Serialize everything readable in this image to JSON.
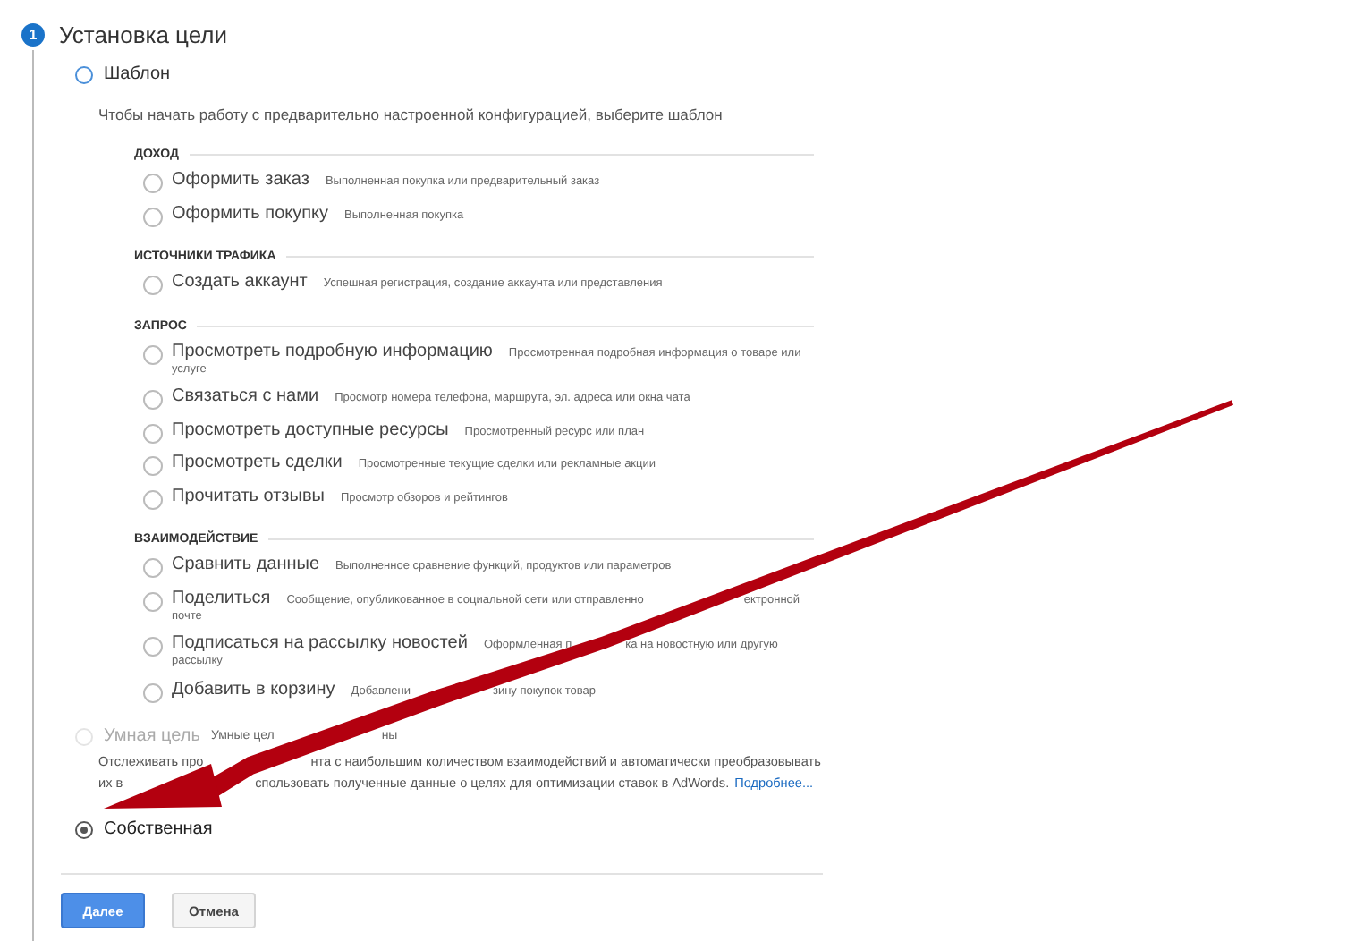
{
  "step": {
    "number": "1",
    "title": "Установка цели"
  },
  "template": {
    "label": "Шаблон",
    "selected": false,
    "hint": "Чтобы начать работу с предварительно настроенной конфигурацией, выберите шаблон",
    "categories": [
      {
        "title": "ДОХОД",
        "options": [
          {
            "label": "Оформить заказ",
            "desc_lines": [
              [
                "Выполненная покупка или предварительный заказ"
              ]
            ],
            "selected": false
          },
          {
            "label": "Оформить покупку",
            "desc_lines": [
              [
                "Выполненная покупка"
              ]
            ],
            "selected": false
          }
        ]
      },
      {
        "title": "ИСТОЧНИКИ ТРАФИКА",
        "options": [
          {
            "label": "Создать аккаунт",
            "desc_lines": [
              [
                "Успешная регистрация, создание аккаунта или представления"
              ]
            ],
            "selected": false
          }
        ]
      },
      {
        "title": "ЗАПРОС",
        "options": [
          {
            "label": "Просмотреть подробную информацию",
            "desc_lines": [
              [
                "Просмотренная подробная информация о товаре или"
              ],
              [
                "услуге"
              ]
            ],
            "selected": false
          },
          {
            "label": "Связаться с нами",
            "desc_lines": [
              [
                "Просмотр номера телефона, маршрута, эл. адреса или окна чата"
              ]
            ],
            "selected": false
          },
          {
            "label": "Просмотреть доступные ресурсы",
            "desc_lines": [
              [
                "Просмотренный ресурс или план"
              ]
            ],
            "selected": false
          },
          {
            "label": "Просмотреть сделки",
            "desc_lines": [
              [
                "Просмотренные текущие сделки или рекламные акции"
              ]
            ],
            "selected": false
          },
          {
            "label": "Прочитать отзывы",
            "desc_lines": [
              [
                "Просмотр обзоров и рейтингов"
              ]
            ],
            "selected": false
          }
        ]
      },
      {
        "title": "ВЗАИМОДЕЙСТВИЕ",
        "options": [
          {
            "label": "Сравнить данные",
            "desc_lines": [
              [
                "Выполненное сравнение функций, продуктов или параметров"
              ]
            ],
            "selected": false
          },
          {
            "label": "Поделиться",
            "desc_lines": [
              [
                "Сообщение, опубликованное в социальной сети или отправленно",
                "ектронной"
              ],
              [
                "почте"
              ]
            ],
            "selected": false
          },
          {
            "label": "Подписаться на рассылку новостей",
            "desc_lines": [
              [
                "Оформленная п",
                "ка на новостную или другую"
              ],
              [
                "рассылку"
              ]
            ],
            "selected": false
          },
          {
            "label": "Добавить в корзину",
            "desc_lines": [
              [
                "Добавлени",
                "зину покупок товар"
              ]
            ],
            "selected": false
          }
        ]
      }
    ]
  },
  "smart": {
    "label": "Умная цель",
    "note": [
      "Умные цел",
      "ны"
    ],
    "disabled": true,
    "selected": false,
    "text_lines": [
      [
        "Отслеживать про",
        "нта с наибольшим количеством взаимодействий и автоматически преобразовывать"
      ],
      [
        "их в",
        "спользовать полученные данные о целях для оптимизации ставок в AdWords."
      ]
    ],
    "link": "Подробнее..."
  },
  "custom": {
    "label": "Собственная",
    "selected": true
  },
  "buttons": [
    {
      "label": "Далее",
      "kind": "primary"
    },
    {
      "label": "Отмена",
      "kind": "secondary"
    }
  ]
}
